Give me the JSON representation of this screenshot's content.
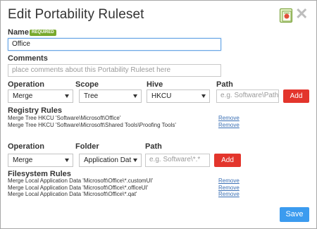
{
  "title": "Edit Portability Ruleset",
  "header_icons": {
    "ruleset_icon": "ruleset-icon",
    "close_icon": "close-icon"
  },
  "name": {
    "label": "Name",
    "badge": "REQUIRED",
    "value": "Office"
  },
  "comments": {
    "label": "Comments",
    "placeholder": "place comments about this Portability Ruleset here"
  },
  "registry": {
    "labels": {
      "operation": "Operation",
      "scope": "Scope",
      "hive": "Hive",
      "path": "Path"
    },
    "operation": "Merge",
    "scope": "Tree",
    "hive": "HKCU",
    "path_placeholder": "e.g. Software\\Path\\",
    "add_label": "Add",
    "rules_label": "Registry Rules",
    "rules": [
      {
        "text": "Merge Tree HKCU 'Software\\Microsoft\\Office'",
        "remove": "Remove"
      },
      {
        "text": "Merge Tree HKCU 'Software\\Microsoft\\Shared Tools\\Proofing Tools'",
        "remove": "Remove"
      }
    ]
  },
  "filesystem": {
    "labels": {
      "operation": "Operation",
      "folder": "Folder",
      "path": "Path"
    },
    "operation": "Merge",
    "folder": "Application Dat",
    "path_placeholder": "e.g. Software\\*.*",
    "add_label": "Add",
    "rules_label": "Filesystem Rules",
    "rules": [
      {
        "text": "Merge Local Application Data 'Microsoft\\Office\\*.customUI'",
        "remove": "Remove"
      },
      {
        "text": "Merge Local Application Data 'Microsoft\\Office\\*.officeUI'",
        "remove": "Remove"
      },
      {
        "text": "Merge Local Application Data 'Microsoft\\Office\\*.qat'",
        "remove": "Remove"
      }
    ]
  },
  "save_label": "Save",
  "colors": {
    "add": "#e3352c",
    "save": "#3b9bef",
    "required_badge": "#78a92d",
    "link": "#3a6fb4"
  }
}
